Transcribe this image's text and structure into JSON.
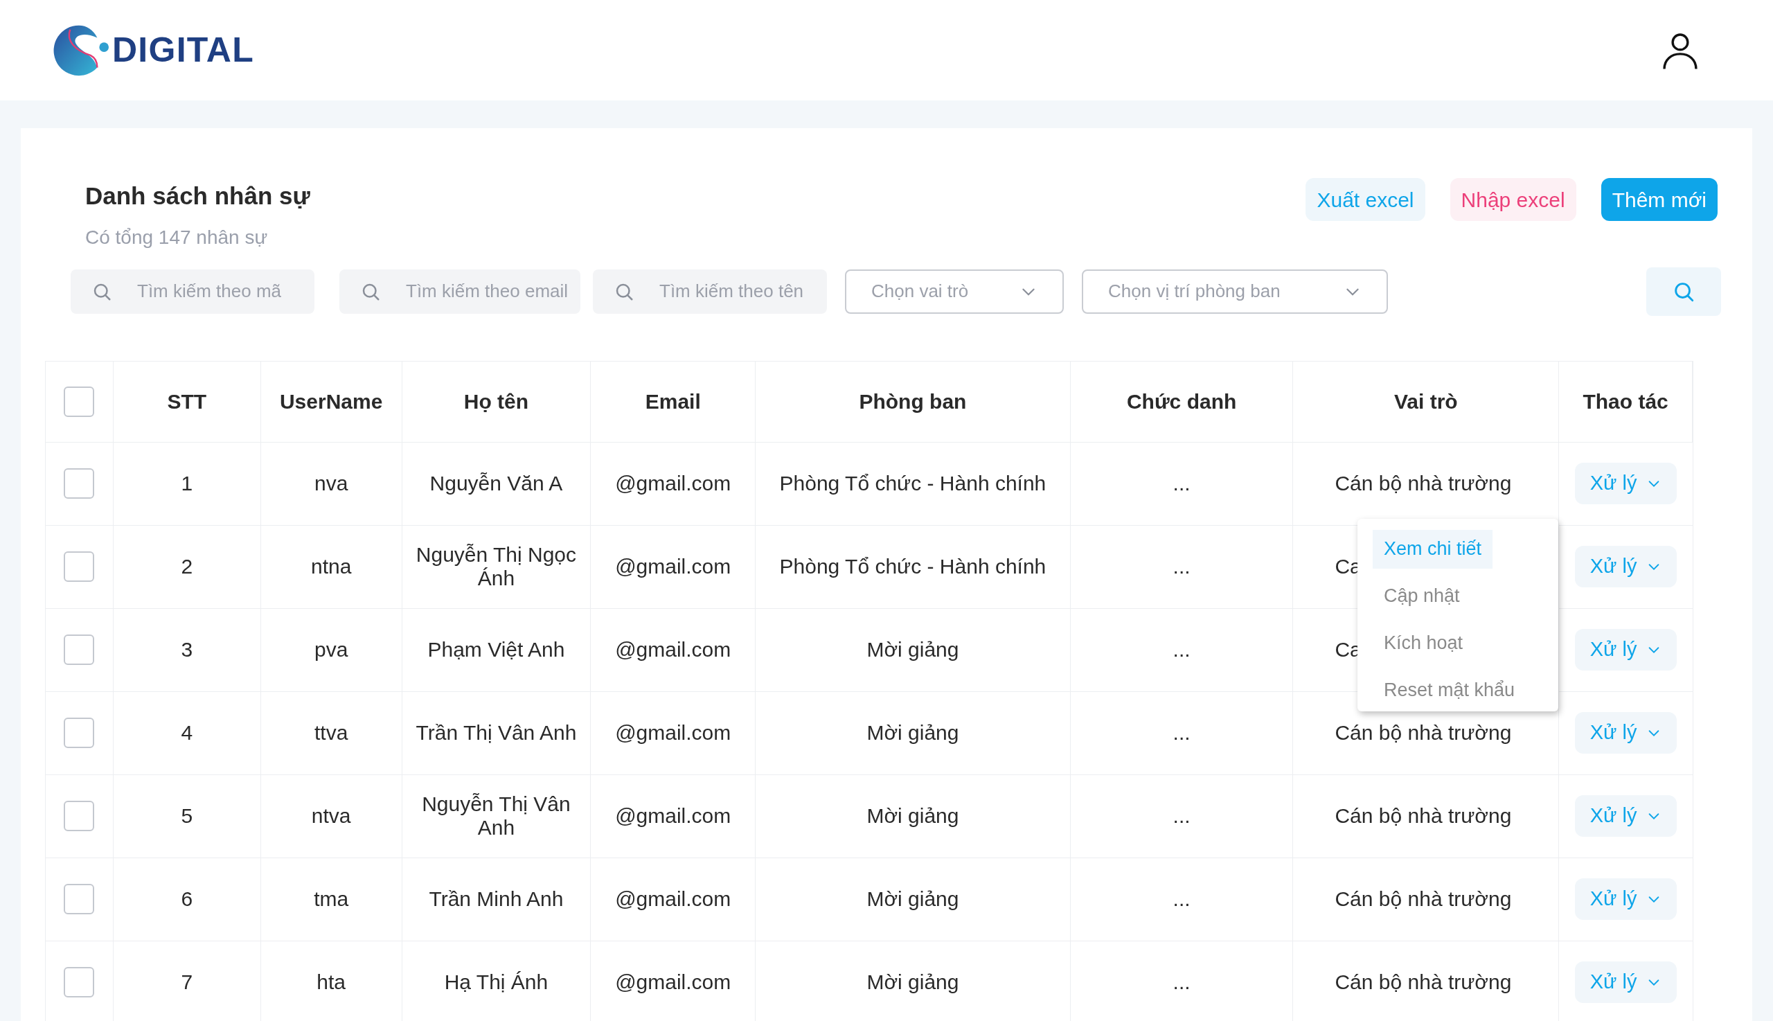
{
  "header": {
    "logo_text": "DIGITAL"
  },
  "page": {
    "title": "Danh sách nhân sự",
    "subtitle": "Có tổng 147 nhân sự"
  },
  "actions": [
    {
      "label": "Xuất excel",
      "kind": "export"
    },
    {
      "label": "Nhập excel",
      "kind": "import"
    },
    {
      "label": "Thêm mới",
      "kind": "primary"
    }
  ],
  "filters": [
    {
      "kind": "search",
      "placeholder": "Tìm kiếm theo mã"
    },
    {
      "kind": "search",
      "placeholder": "Tìm kiếm theo email"
    },
    {
      "kind": "search",
      "placeholder": "Tìm kiếm theo tên"
    },
    {
      "kind": "select",
      "placeholder": "Chọn vai trò"
    },
    {
      "kind": "select",
      "placeholder": "Chọn vị trí phòng ban"
    }
  ],
  "table": {
    "select_all": {
      "checked": false
    },
    "columns": [
      "STT",
      "UserName",
      "Họ tên",
      "Email",
      "Phòng ban",
      "Chức danh",
      "Vai trò",
      "Thao tác"
    ],
    "rows": [
      {
        "checked": false,
        "stt": "1",
        "username": "nva",
        "ho_ten": "Nguyễn Văn A",
        "email": "@gmail.com",
        "phong_ban": "Phòng Tổ chức - Hành chính",
        "chuc_danh": "...",
        "vai_tro": "Cán bộ nhà trường",
        "action": "Xử lý"
      },
      {
        "checked": false,
        "stt": "2",
        "username": "ntna",
        "ho_ten": "Nguyễn Thị Ngọc Ánh",
        "email": "@gmail.com",
        "phong_ban": "Phòng Tổ chức - Hành chính",
        "chuc_danh": "...",
        "vai_tro": "Ca",
        "action": "Xử lý"
      },
      {
        "checked": false,
        "stt": "3",
        "username": "pva",
        "ho_ten": "Phạm Việt Anh",
        "email": "@gmail.com",
        "phong_ban": "Mời giảng",
        "chuc_danh": "...",
        "vai_tro": "Ca",
        "action": "Xử lý"
      },
      {
        "checked": false,
        "stt": "4",
        "username": "ttva",
        "ho_ten": "Trần Thị Vân Anh",
        "email": "@gmail.com",
        "phong_ban": "Mời giảng",
        "chuc_danh": "...",
        "vai_tro": "Cán bộ nhà trường",
        "action": "Xử lý"
      },
      {
        "checked": false,
        "stt": "5",
        "username": "ntva",
        "ho_ten": "Nguyễn Thị Vân Anh",
        "email": "@gmail.com",
        "phong_ban": "Mời giảng",
        "chuc_danh": "...",
        "vai_tro": "Cán bộ nhà trường",
        "action": "Xử lý"
      },
      {
        "checked": false,
        "stt": "6",
        "username": "tma",
        "ho_ten": "Trần Minh Anh",
        "email": "@gmail.com",
        "phong_ban": "Mời giảng",
        "chuc_danh": "...",
        "vai_tro": "Cán bộ nhà trường",
        "action": "Xử lý"
      },
      {
        "checked": false,
        "stt": "7",
        "username": "hta",
        "ho_ten": "Hạ Thị Ánh",
        "email": "@gmail.com",
        "phong_ban": "Mời giảng",
        "chuc_danh": "...",
        "vai_tro": "Cán bộ nhà trường",
        "action": "Xử lý"
      }
    ]
  },
  "action_menu": {
    "items": [
      {
        "label": "Xem chi tiết",
        "selected": true
      },
      {
        "label": "Cập nhật",
        "selected": false
      },
      {
        "label": "Kích hoạt",
        "selected": false
      },
      {
        "label": "Reset mật khẩu",
        "selected": false
      }
    ]
  }
}
